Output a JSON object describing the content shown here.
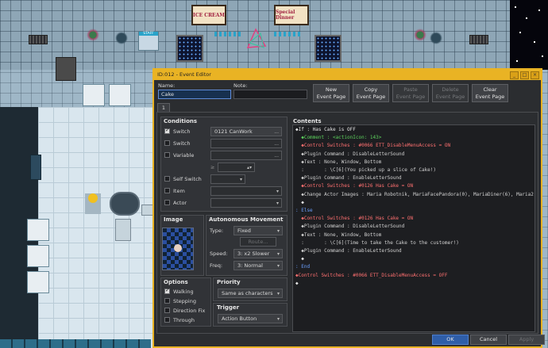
{
  "window": {
    "title": "ID:012 - Event Editor",
    "buttons": [
      "_",
      "□",
      "×"
    ]
  },
  "name": {
    "label": "Name:",
    "value": "Cake"
  },
  "note": {
    "label": "Note:",
    "value": ""
  },
  "toolbar": [
    {
      "line1": "New",
      "line2": "Event Page",
      "enabled": true
    },
    {
      "line1": "Copy",
      "line2": "Event Page",
      "enabled": true
    },
    {
      "line1": "Paste",
      "line2": "Event Page",
      "enabled": false
    },
    {
      "line1": "Delete",
      "line2": "Event Page",
      "enabled": false
    },
    {
      "line1": "Clear",
      "line2": "Event Page",
      "enabled": true
    }
  ],
  "tab": "1",
  "conditions": {
    "title": "Conditions",
    "switch1": {
      "label": "Switch",
      "checked": true,
      "value": "0121 CanWork",
      "btn": "..."
    },
    "switch2": {
      "label": "Switch",
      "checked": false,
      "value": "",
      "btn": "..."
    },
    "variable": {
      "label": "Variable",
      "checked": false,
      "value": "",
      "btn": "..."
    },
    "ge": "≥",
    "self_switch": {
      "label": "Self Switch",
      "checked": false
    },
    "item": {
      "label": "Item",
      "checked": false
    },
    "actor": {
      "label": "Actor",
      "checked": false
    }
  },
  "image": {
    "title": "Image"
  },
  "autonomous": {
    "title": "Autonomous Movement",
    "type_label": "Type:",
    "type_value": "Fixed",
    "route_label": "Route...",
    "speed_label": "Speed:",
    "speed_value": "3: x2 Slower",
    "freq_label": "Freq:",
    "freq_value": "3: Normal"
  },
  "options": {
    "title": "Options",
    "items": [
      {
        "label": "Walking",
        "checked": true
      },
      {
        "label": "Stepping",
        "checked": false
      },
      {
        "label": "Direction Fix",
        "checked": false
      },
      {
        "label": "Through",
        "checked": false
      }
    ]
  },
  "priority": {
    "title": "Priority",
    "value": "Same as characters"
  },
  "trigger": {
    "title": "Trigger",
    "value": "Action Button"
  },
  "contents": {
    "title": "Contents",
    "lines": [
      {
        "t": "◆If : Has Cake is OFF",
        "c": "c-white"
      },
      {
        "t": "  ◆Comment : <actionIcon: 143>",
        "c": "c-green"
      },
      {
        "t": "  ◆Control Switches : #0066 ETT_DisableMenuAccess = ON",
        "c": "c-red"
      },
      {
        "t": "  ◆Plugin Command : DisableLetterSound",
        "c": "c-gray"
      },
      {
        "t": "  ◆Text : None, Window, Bottom",
        "c": "c-gray"
      },
      {
        "t": "  :       : \\C[6](You picked up a slice of Cake!)",
        "c": "c-gray"
      },
      {
        "t": "  ◆Plugin Command : EnableLetterSound",
        "c": "c-gray"
      },
      {
        "t": "  ◆Control Switches : #0126 Has Cake = ON",
        "c": "c-red"
      },
      {
        "t": "  ◆Change Actor Images : Maria Robotnik, MariaFacePandora(0), MariaDiner(6), Maria2",
        "c": "c-gray"
      },
      {
        "t": "  ◆",
        "c": "c-white"
      },
      {
        "t": ": Else",
        "c": "c-blue"
      },
      {
        "t": "  ◆Control Switches : #0126 Has Cake = ON",
        "c": "c-red"
      },
      {
        "t": "  ◆Plugin Command : DisableLetterSound",
        "c": "c-gray"
      },
      {
        "t": "  ◆Text : None, Window, Bottom",
        "c": "c-gray"
      },
      {
        "t": "  :       : \\C[6](Time to take the Cake to the customer!)",
        "c": "c-gray"
      },
      {
        "t": "  ◆Plugin Command : EnableLetterSound",
        "c": "c-gray"
      },
      {
        "t": "  ◆",
        "c": "c-white"
      },
      {
        "t": ": End",
        "c": "c-blue"
      },
      {
        "t": "◆Control Switches : #0066 ETT_DisableMenuAccess = OFF",
        "c": "c-red"
      },
      {
        "t": "◆",
        "c": "c-white"
      }
    ]
  },
  "footer": {
    "ok": "OK",
    "cancel": "Cancel",
    "apply": "Apply"
  },
  "map": {
    "sign1": "ICE CREAM",
    "sign2": "Special Dinner",
    "staff": "STAFF"
  },
  "colors": {
    "titlebar": "#e9b324",
    "dialog_bg": "#2b2d30",
    "primary": "#2f5ea8"
  }
}
